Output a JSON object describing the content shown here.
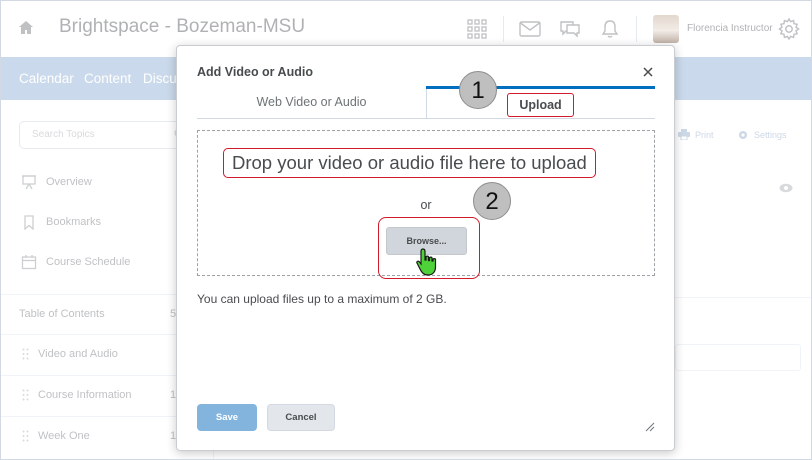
{
  "header": {
    "app_title": "Brightspace - Bozeman-MSU",
    "user_name": "Florencia Instructor",
    "icons": [
      "home-icon",
      "grid-icon",
      "mail-icon",
      "chat-icon",
      "bell-icon",
      "gear-icon"
    ]
  },
  "nav": {
    "items": [
      "Calendar",
      "Content",
      "Discu"
    ]
  },
  "sidebar": {
    "search_placeholder": "Search Topics",
    "items": [
      {
        "label": "Overview",
        "icon": "presentation-icon"
      },
      {
        "label": "Bookmarks",
        "icon": "bookmark-icon"
      },
      {
        "label": "Course Schedule",
        "icon": "calendar-icon"
      }
    ],
    "toc_label": "Table of Contents",
    "toc_count": "5",
    "modules": [
      {
        "label": "Video and Audio",
        "count": ""
      },
      {
        "label": "Course Information",
        "count": "1"
      },
      {
        "label": "Week One",
        "count": "1"
      }
    ]
  },
  "background": {
    "print_label": "Print",
    "settings_label": "Settings"
  },
  "dialog": {
    "title": "Add Video or Audio",
    "tabs": [
      {
        "label": "Web Video or Audio",
        "selected": false
      },
      {
        "label": "Upload",
        "selected": true
      }
    ],
    "drop_text": "Drop your video or audio file here to upload",
    "or_text": "or",
    "browse_label": "Browse...",
    "max_upload_text": "You can upload files up to a maximum of 2 GB.",
    "save_label": "Save",
    "cancel_label": "Cancel"
  },
  "callouts": {
    "step1": "1",
    "step2": "2"
  },
  "colors": {
    "nav_bar": "#9fbadb",
    "tab_accent": "#006fbf",
    "highlight_red": "#d11a2a",
    "save_button": "#83b4dd",
    "hand_cursor": "#4fd13a"
  }
}
